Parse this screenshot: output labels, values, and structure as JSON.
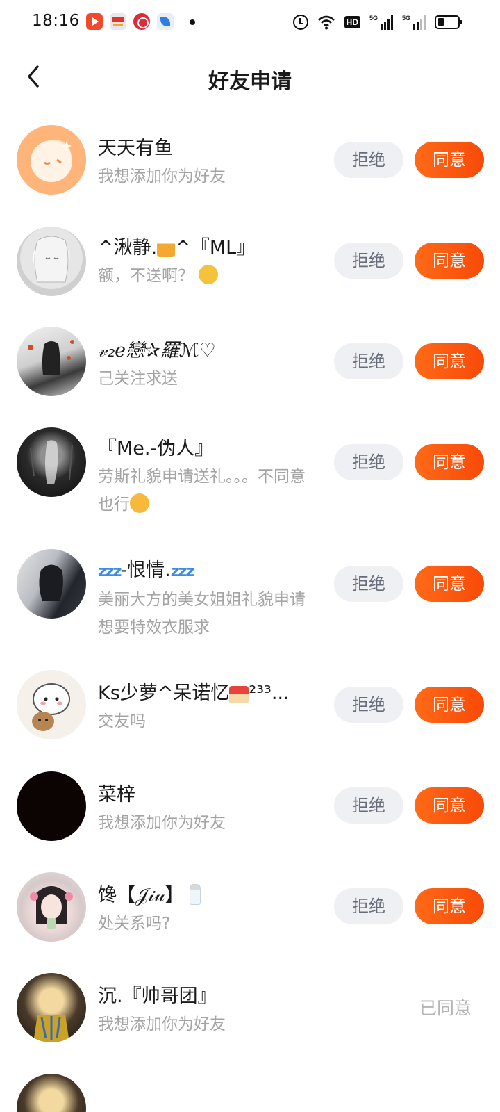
{
  "status_bar": {
    "time": "18:16",
    "notifications": [
      "video-app-icon",
      "toutiao-news-icon",
      "heart-app-icon",
      "bird-app-icon"
    ],
    "network": "5G",
    "hd_badge": "HD"
  },
  "header": {
    "title": "好友申请",
    "back_icon": "chevron-left-icon"
  },
  "colors": {
    "accent": "#fb5a0e",
    "reject_bg": "#eef0f4",
    "reject_text": "#666c78",
    "secondary_text": "#a4a4a4"
  },
  "labels": {
    "reject": "拒绝",
    "accept": "同意",
    "accepted": "已同意"
  },
  "requests": [
    {
      "name": "天天有鱼",
      "message": "我想添加你为好友",
      "status": "pending"
    },
    {
      "name": "^湫静.",
      "name_suffix": "^『ML』",
      "message": "额，不送啊？",
      "status": "pending"
    },
    {
      "name": "𝓋₂ℯ戀✰羅ℳ♡",
      "message": "己关注求送",
      "status": "pending"
    },
    {
      "name": "『Me.-伪人』",
      "message": "劳斯礼貌申请送礼。。。不同意也行",
      "status": "pending"
    },
    {
      "name": "-恨情.",
      "message": "美丽大方的美女姐姐礼貌申请想要特效衣服求",
      "status": "pending"
    },
    {
      "name": "Ks少萝^呆诺忆",
      "name_suffix": "²³³...",
      "message": "交友吗",
      "status": "pending"
    },
    {
      "name": "菜梓",
      "message": "我想添加你为好友",
      "status": "pending"
    },
    {
      "name": "馋【𝒥𝒾𝓊】",
      "message": "处关系吗?",
      "status": "pending"
    },
    {
      "name": "沉.『帅哥团』",
      "message": "我想添加你为好友",
      "status": "accepted"
    }
  ]
}
